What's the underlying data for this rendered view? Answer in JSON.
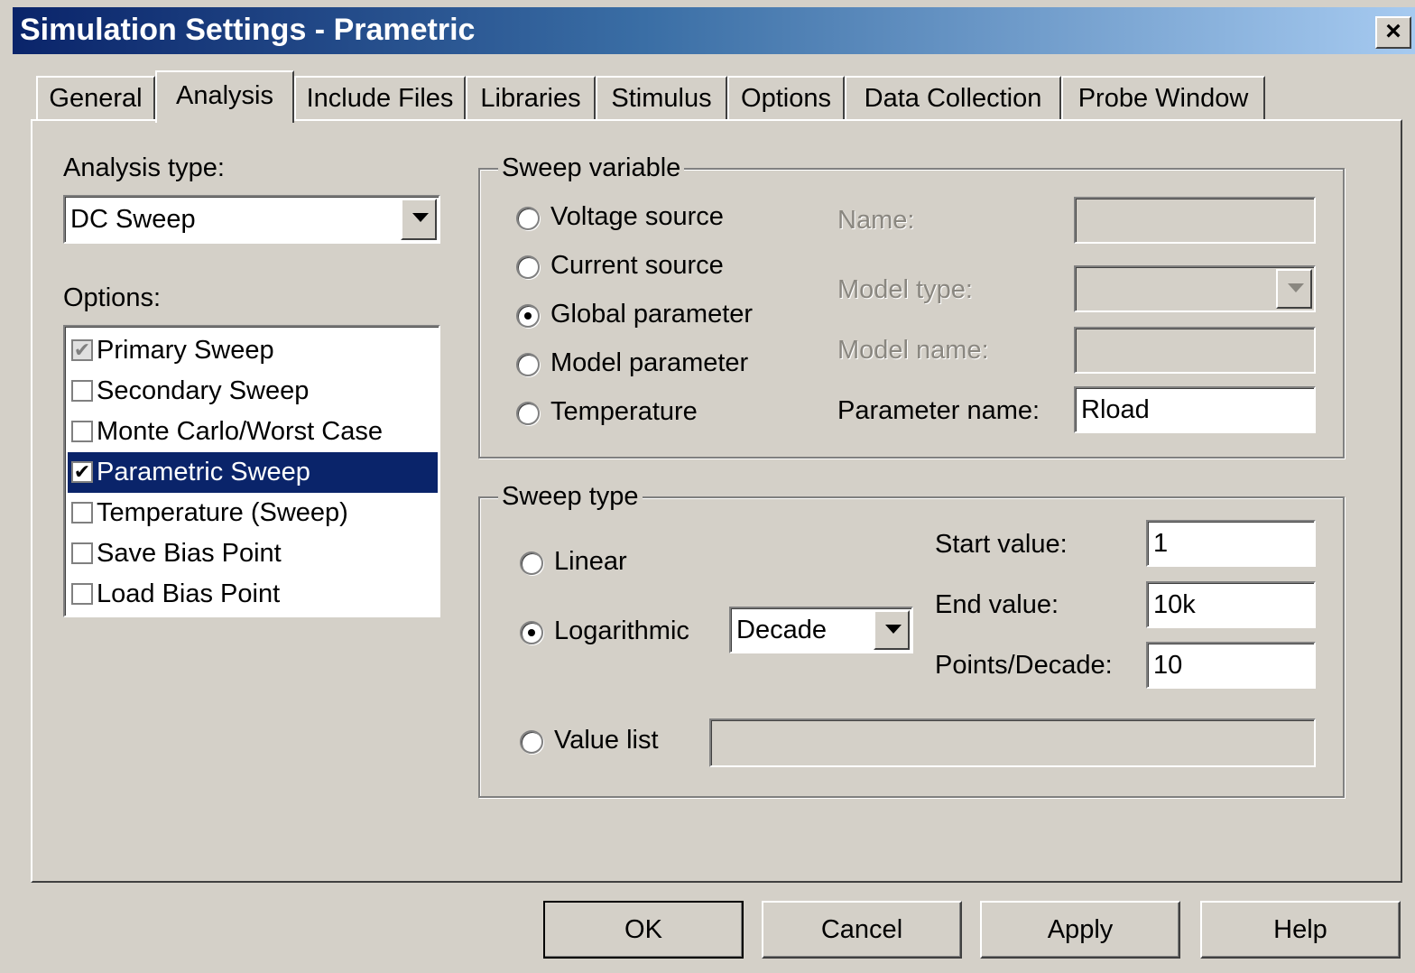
{
  "window": {
    "title": "Simulation Settings - Prametric",
    "close_label": "×"
  },
  "tabs": [
    {
      "label": "General"
    },
    {
      "label": "Analysis"
    },
    {
      "label": "Include Files"
    },
    {
      "label": "Libraries"
    },
    {
      "label": "Stimulus"
    },
    {
      "label": "Options"
    },
    {
      "label": "Data Collection"
    },
    {
      "label": "Probe Window"
    }
  ],
  "analysis": {
    "type_label": "Analysis type:",
    "type_value": "DC Sweep",
    "options_label": "Options:",
    "options": [
      {
        "label": "Primary Sweep",
        "checked": true,
        "greyed": true,
        "selected": false
      },
      {
        "label": "Secondary Sweep",
        "checked": false,
        "greyed": false,
        "selected": false
      },
      {
        "label": "Monte Carlo/Worst Case",
        "checked": false,
        "greyed": false,
        "selected": false
      },
      {
        "label": "Parametric Sweep",
        "checked": true,
        "greyed": false,
        "selected": true
      },
      {
        "label": "Temperature (Sweep)",
        "checked": false,
        "greyed": false,
        "selected": false
      },
      {
        "label": "Save Bias Point",
        "checked": false,
        "greyed": false,
        "selected": false
      },
      {
        "label": "Load Bias Point",
        "checked": false,
        "greyed": false,
        "selected": false
      }
    ]
  },
  "sweep_variable": {
    "legend": "Sweep variable",
    "options": [
      {
        "label": "Voltage source",
        "selected": false
      },
      {
        "label": "Current source",
        "selected": false
      },
      {
        "label": "Global parameter",
        "selected": true
      },
      {
        "label": "Model parameter",
        "selected": false
      },
      {
        "label": "Temperature",
        "selected": false
      }
    ],
    "name_label": "Name:",
    "name_value": "",
    "model_type_label": "Model type:",
    "model_type_value": "",
    "model_name_label": "Model name:",
    "model_name_value": "",
    "parameter_name_label": "Parameter name:",
    "parameter_name_value": "Rload"
  },
  "sweep_type": {
    "legend": "Sweep type",
    "linear_label": "Linear",
    "log_label": "Logarithmic",
    "log_scale_value": "Decade",
    "value_list_label": "Value list",
    "value_list_value": "",
    "selected": "Logarithmic",
    "start_label": "Start value:",
    "start_value": "1",
    "end_label": "End value:",
    "end_value": "10k",
    "points_label": "Points/Decade:",
    "points_value": "10"
  },
  "buttons": {
    "ok": "OK",
    "cancel": "Cancel",
    "apply": "Apply",
    "help": "Help"
  }
}
